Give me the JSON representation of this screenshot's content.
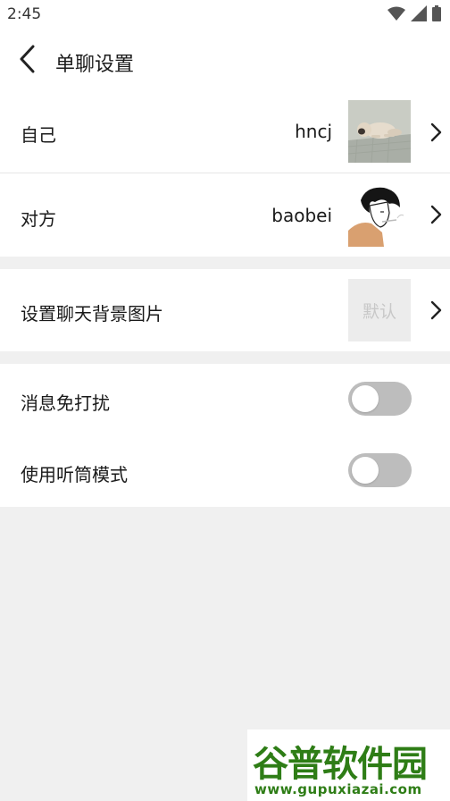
{
  "status_bar": {
    "time": "2:45",
    "icons": [
      "wifi-icon",
      "signal-icon",
      "battery-icon"
    ]
  },
  "header": {
    "title": "单聊设置",
    "back_icon": "chevron-left-icon"
  },
  "rows": {
    "self": {
      "label": "自己",
      "value": "hncj"
    },
    "other": {
      "label": "对方",
      "value": "baobei"
    },
    "background": {
      "label": "设置聊天背景图片",
      "default_text": "默认"
    },
    "mute": {
      "label": "消息免打扰",
      "enabled": false
    },
    "earpiece": {
      "label": "使用听筒模式",
      "enabled": false
    }
  },
  "watermark": {
    "logo_text": "谷普软件园",
    "url": "www.gupuxiazai.com"
  },
  "colors": {
    "background": "#f0f0f0",
    "surface": "#ffffff",
    "toggle_off": "#bdbdbd",
    "watermark_green": "#2e7d16"
  }
}
